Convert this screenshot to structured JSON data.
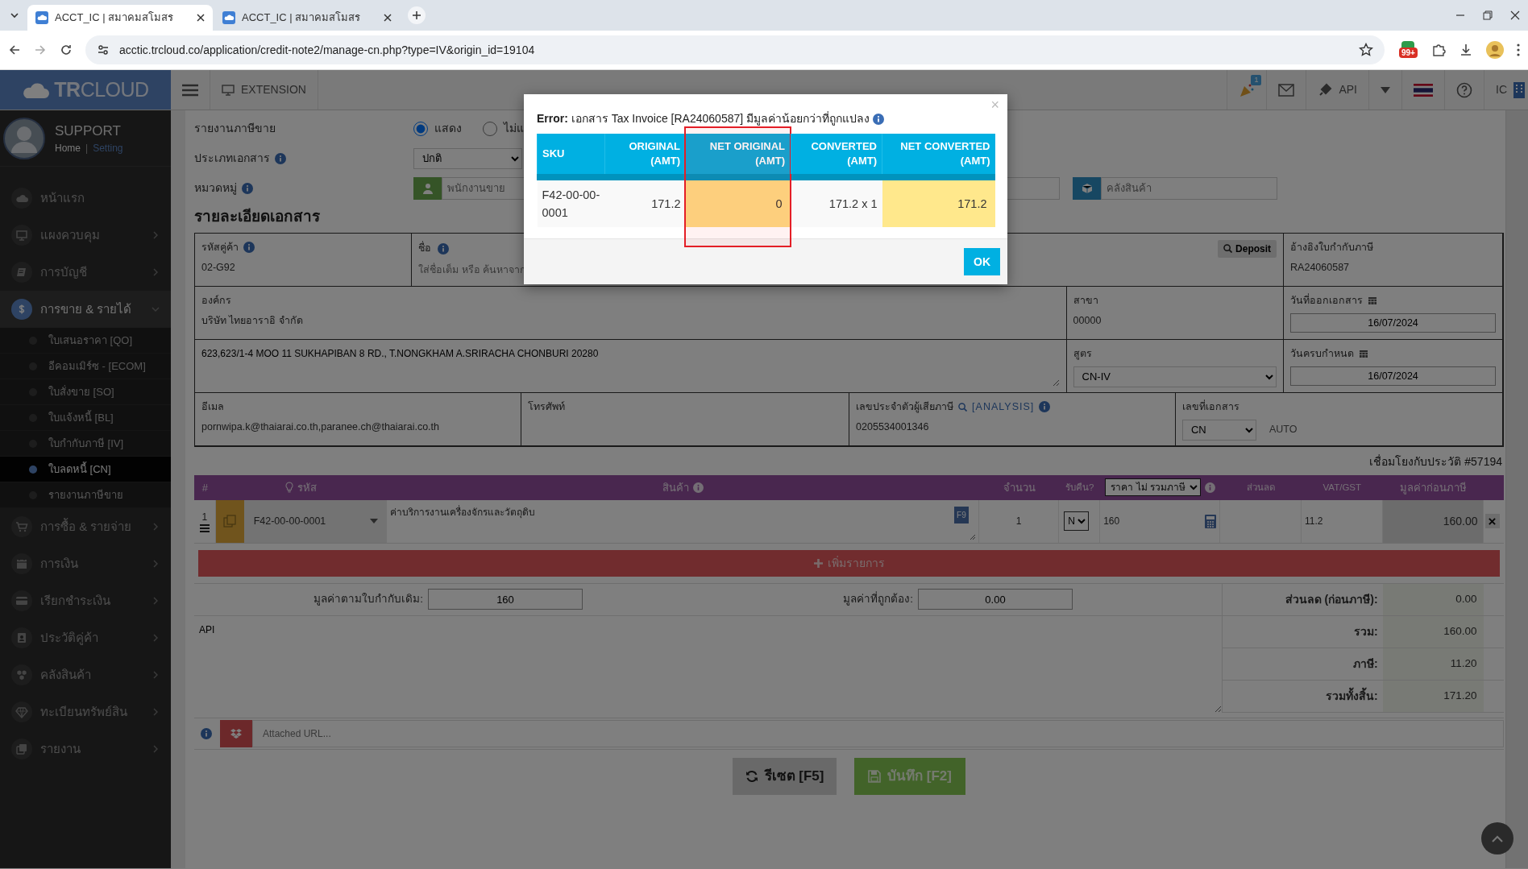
{
  "browser": {
    "tabs": [
      {
        "title": "ACCT_IC | สมาคมสโมสร",
        "selected": true
      },
      {
        "title": "ACCT_IC | สมาคมสโมสร",
        "selected": false
      }
    ],
    "address": "acctic.trcloud.co/application/credit-note2/manage-cn.php?type=IV&origin_id=19104",
    "extension_badge": "99+"
  },
  "header": {
    "logo": "**TR**CLOUD",
    "extension": "EXTENSION",
    "notification_count": "1",
    "api": "API",
    "user": "IC"
  },
  "sidebar": {
    "user": "SUPPORT",
    "links": [
      "Home",
      "Setting"
    ],
    "separator": "|",
    "items": [
      {
        "label": "หน้าแรก",
        "selected": false,
        "submenu": false
      },
      {
        "label": "แผงควบคุม",
        "selected": false,
        "submenu": true,
        "expanded": false
      },
      {
        "label": "การบัญชี",
        "selected": false,
        "submenu": true,
        "expanded": false
      },
      {
        "label": "การขาย & รายได้",
        "selected": true,
        "submenu": true,
        "expanded": true,
        "children": [
          {
            "label": "ใบเสนอราคา [QO]",
            "selected": false
          },
          {
            "label": "อีคอมเมิร์ซ - [ECOM]",
            "selected": false
          },
          {
            "label": "ใบสั่งขาย [SO]",
            "selected": false
          },
          {
            "label": "ใบแจ้งหนี้ [BL]",
            "selected": false
          },
          {
            "label": "ใบกำกับภาษี [IV]",
            "selected": false
          },
          {
            "label": "ใบลดหนี้ [CN]",
            "selected": true
          },
          {
            "label": "รายงานภาษีขาย",
            "selected": false
          }
        ]
      },
      {
        "label": "การซื้อ & รายจ่าย",
        "selected": false,
        "submenu": true,
        "expanded": false
      },
      {
        "label": "การเงิน",
        "selected": false,
        "submenu": true,
        "expanded": false
      },
      {
        "label": "เรียกชำระเงิน",
        "selected": false,
        "submenu": true,
        "expanded": false
      },
      {
        "label": "ประวัติคู่ค้า",
        "selected": false,
        "submenu": true,
        "expanded": false
      },
      {
        "label": "คลังสินค้า",
        "selected": false,
        "submenu": true,
        "expanded": false
      },
      {
        "label": "ทะเบียนทรัพย์สิน",
        "selected": false,
        "submenu": true,
        "expanded": false
      },
      {
        "label": "รายงาน",
        "selected": false,
        "submenu": true,
        "expanded": false
      }
    ]
  },
  "form": {
    "sales_tax_report": {
      "label": "รายงานภาษีขาย",
      "options": [
        {
          "label": "แสดง",
          "selected": true
        },
        {
          "label": "ไม่แ",
          "selected": false
        }
      ]
    },
    "doc_type": {
      "label": "ประเภทเอกสาร",
      "value": "ปกติ"
    },
    "category": {
      "label": "หมวดหมู่",
      "placeholder": "พนักงานขาย",
      "warehouse_placeholder": "คลังสินค้า"
    },
    "section_title": "รายละเอียดเอกสาร",
    "partner_code": {
      "label": "รหัสคู่ค้า",
      "value": "02-G92"
    },
    "name": {
      "label": "ชื่อ",
      "placeholder": "ใส่ชื่อเต็ม หรือ ค้นหาจาก",
      "button": "Deposit"
    },
    "tax_invoice_ref": {
      "label": "อ้างอิงใบกำกับภาษี",
      "value": "RA24060587"
    },
    "organization": {
      "label": "องค์กร",
      "value": "บริษัท ไทยอาราอิ จำกัด"
    },
    "branch": {
      "label": "สาขา",
      "value": "00000"
    },
    "issue_date": {
      "label": "วันที่ออกเอกสาร",
      "value": "16/07/2024"
    },
    "address": {
      "value": "623,623/1-4 MOO 11 SUKHAPIBAN 8 RD., T.NONGKHAM A.SRIRACHA CHONBURI 20280"
    },
    "formula": {
      "label": "สูตร",
      "value": "CN-IV"
    },
    "due_date": {
      "label": "วันครบกำหนด",
      "value": "16/07/2024"
    },
    "email": {
      "label": "อีเมล",
      "value": "pornwipa.k@thaiarai.co.th,paranee.ch@thaiarai.co.th"
    },
    "phone": {
      "label": "โทรศัพท์"
    },
    "tax_id": {
      "label": "เลขประจำตัวผู้เสียภาษี",
      "link": "[ANALYSIS]",
      "value": "0205534001346"
    },
    "doc_number": {
      "label": "เลขที่เอกสาร",
      "value": "CN",
      "note": "AUTO"
    },
    "link_note": "เชื่อมโยงกับประวัติ #57194"
  },
  "items": {
    "columns": [
      {
        "label": "#",
        "kind": "text"
      },
      {
        "label": "รหัส",
        "kind": "code"
      },
      {
        "label": "สินค้า",
        "kind": "info"
      },
      {
        "label": "จำนวน",
        "kind": "text"
      },
      {
        "label": "รับคืน?",
        "kind": "small"
      },
      {
        "label": "ราคา ไม่ รวมภาษี",
        "kind": "select"
      },
      {
        "label": "ส่วนลด",
        "kind": "small"
      },
      {
        "label": "VAT/GST",
        "kind": "small"
      },
      {
        "label": "มูลค่าก่อนภาษี",
        "kind": "text"
      }
    ],
    "rows": [
      {
        "no": "1",
        "code": "F42-00-00-0001",
        "description": "ค่าบริการงานเครื่องจักรและวัตถุดิบ",
        "key_hint": "F9",
        "qty": "1",
        "return": "N",
        "price": "160",
        "vat": "11.2",
        "amount": "160.00"
      }
    ],
    "add_button": "เพิ่มรายการ"
  },
  "summary": {
    "original_label": "มูลค่าตามใบกำกับเดิม:",
    "original_value": "160",
    "correct_label": "มูลค่าที่ถูกต้อง:",
    "correct_value": "0.00",
    "note": "API",
    "totals": [
      {
        "label": "ส่วนลด (ก่อนภาษี):",
        "value": "0.00"
      },
      {
        "label": "รวม:",
        "value": "160.00"
      },
      {
        "label": "ภาษี:",
        "value": "11.20"
      },
      {
        "label": "รวมทั้งสิ้น:",
        "value": "171.20"
      }
    ]
  },
  "attachment": {
    "placeholder": "Attached URL..."
  },
  "actions": {
    "reset": "รีเซต [F5]",
    "save": "บันทึก [F2]"
  },
  "modal": {
    "title": "**Error:** เอกสาร Tax Invoice [RA24060587] มีมูลค่าน้อยกว่าที่ถูกแปลง",
    "close": "×",
    "columns": [
      {
        "label": "SKU",
        "marked": false
      },
      {
        "label": "ORIGINAL (AMT)",
        "marked": false
      },
      {
        "label": "NET ORIGINAL (AMT)",
        "marked": true
      },
      {
        "label": "CONVERTED (AMT)",
        "marked": false
      },
      {
        "label": "NET CONVERTED (AMT)",
        "marked": false
      }
    ],
    "rows": [
      {
        "cells": [
          {
            "text": "F42-00-00-0001"
          },
          {
            "text": "171.2"
          },
          {
            "text": "0",
            "color": "#fddb84"
          },
          {
            "text": "171.2 x 1"
          },
          {
            "text": "171.2",
            "color": "#ffe88c"
          }
        ]
      }
    ],
    "ok": "OK"
  }
}
